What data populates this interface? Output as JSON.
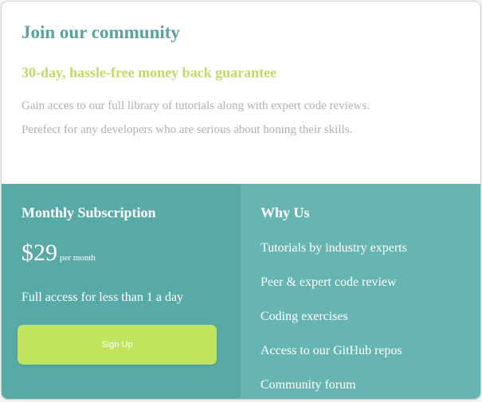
{
  "header": {
    "title": "Join our community",
    "subtitle": "30-day, hassle-free money back guarantee",
    "description_line1": "Gain acces to our full library of tutorials along with expert code reviews.",
    "description_line2": "Perefect for any developers who are serious about honing their skills."
  },
  "subscription": {
    "title": "Monthly Subscription",
    "price": "$29",
    "period": "per month",
    "tagline": "Full access for less than 1 a day",
    "signup_label": "Sign Up"
  },
  "why_us": {
    "title": "Why Us",
    "items": [
      "Tutorials by industry experts",
      "Peer & expert code review",
      "Coding exercises",
      "Access to our GitHub repos",
      "Community forum"
    ]
  },
  "colors": {
    "title": "#58a39d",
    "subtitle": "#c5d867",
    "body_text": "#aeb0b8",
    "left_panel": "#57aaa6",
    "right_panel": "#66b5b2",
    "button": "#c0e45d"
  }
}
